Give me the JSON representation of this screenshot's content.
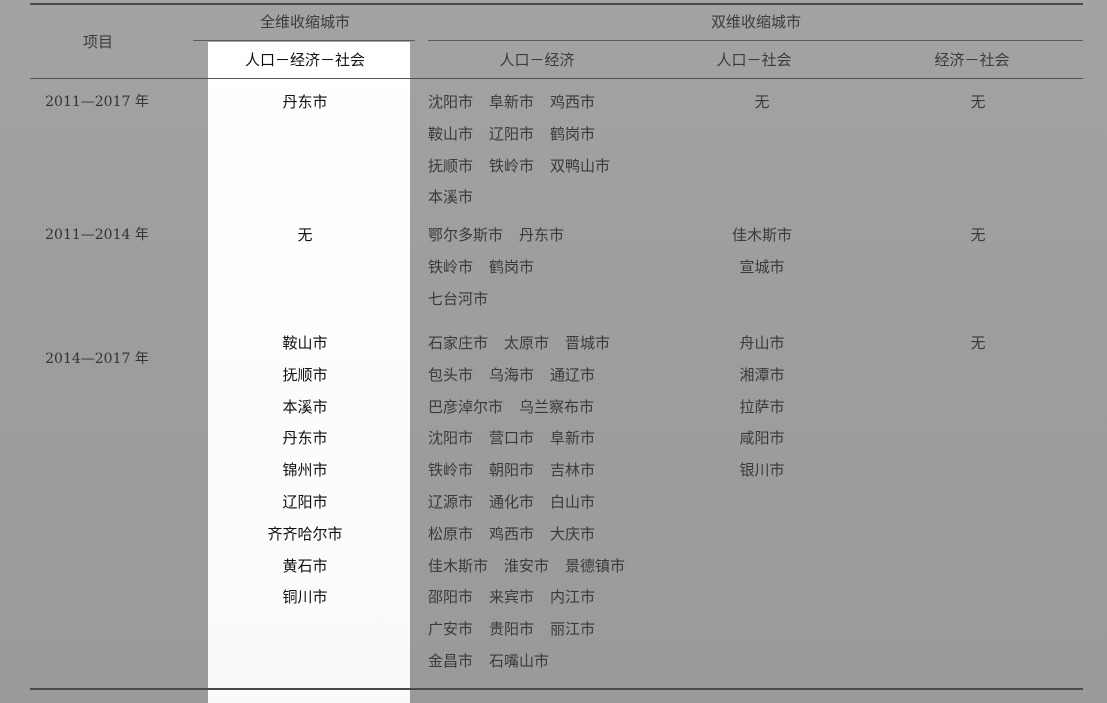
{
  "header": {
    "item_col": "项目",
    "full_group": "全维收缩城市",
    "full_sub": "人口－经济－社会",
    "dual_group": "双维收缩城市",
    "dual_sub1": "人口－经济",
    "dual_sub2": "人口－社会",
    "dual_sub3": "经济－社会"
  },
  "rows": [
    {
      "period": "2011—2017 年",
      "full": [
        "丹东市"
      ],
      "pop_econ": [
        [
          "沈阳市",
          "阜新市",
          "鸡西市"
        ],
        [
          "鞍山市",
          "辽阳市",
          "鹤岗市"
        ],
        [
          "抚顺市",
          "铁岭市",
          "双鸭山市"
        ],
        [
          "本溪市"
        ]
      ],
      "pop_soc": [
        "无"
      ],
      "econ_soc": [
        "无"
      ]
    },
    {
      "period": "2011—2014 年",
      "full": [
        "无"
      ],
      "pop_econ": [
        [
          "鄂尔多斯市",
          "丹东市"
        ],
        [
          "铁岭市",
          "鹤岗市"
        ],
        [
          "七台河市"
        ]
      ],
      "pop_soc": [
        "佳木斯市",
        "宣城市"
      ],
      "econ_soc": [
        "无"
      ]
    },
    {
      "period": "2014—2017 年",
      "full": [
        "鞍山市",
        "抚顺市",
        "本溪市",
        "丹东市",
        "锦州市",
        "辽阳市",
        "齐齐哈尔市",
        "黄石市",
        "铜川市"
      ],
      "pop_econ": [
        [
          "石家庄市",
          "太原市",
          "晋城市"
        ],
        [
          "包头市",
          "乌海市",
          "通辽市"
        ],
        [
          "巴彦淖尔市",
          "乌兰察布市"
        ],
        [
          "沈阳市",
          "营口市",
          "阜新市"
        ],
        [
          "铁岭市",
          "朝阳市",
          "吉林市"
        ],
        [
          "辽源市",
          "通化市",
          "白山市"
        ],
        [
          "松原市",
          "鸡西市",
          "大庆市"
        ],
        [
          "佳木斯市",
          "淮安市",
          "景德镇市"
        ],
        [
          "邵阳市",
          "来宾市",
          "内江市"
        ],
        [
          "广安市",
          "贵阳市",
          "丽江市"
        ],
        [
          "金昌市",
          "石嘴山市"
        ]
      ],
      "pop_soc": [
        "舟山市",
        "湘潭市",
        "拉萨市",
        "咸阳市",
        "银川市"
      ],
      "econ_soc": [
        "无"
      ]
    }
  ]
}
